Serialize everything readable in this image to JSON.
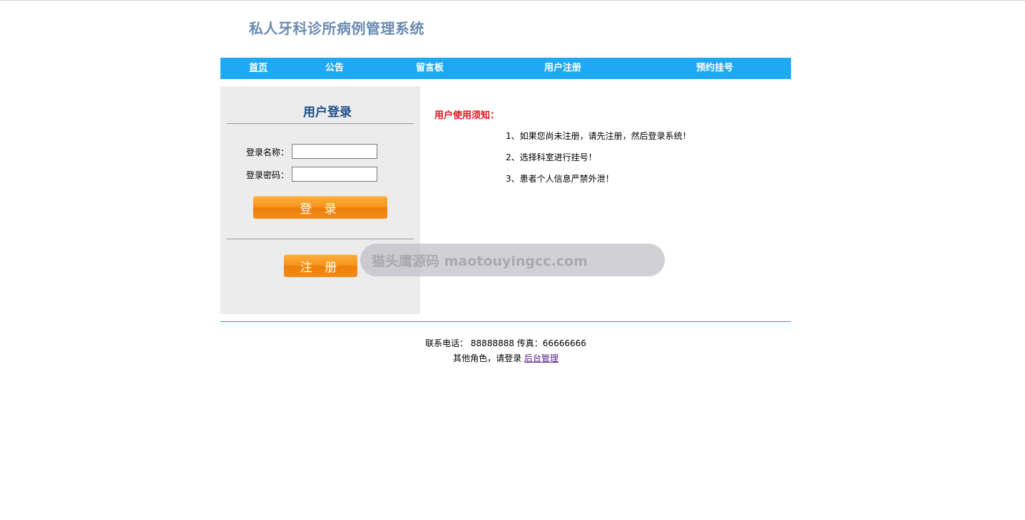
{
  "header": {
    "title": "私人牙科诊所病例管理系统"
  },
  "nav": {
    "items": [
      {
        "label": "首页"
      },
      {
        "label": "公告"
      },
      {
        "label": "留言板"
      },
      {
        "label": "用户注册"
      },
      {
        "label": "预约挂号"
      }
    ]
  },
  "login": {
    "title": "用户登录",
    "username_label": "登录名称：",
    "username_value": "",
    "password_label": "登录密码：",
    "password_value": "",
    "login_button": "登 录",
    "register_button": "注 册"
  },
  "notice": {
    "title": "用户使用须知：",
    "items": [
      "1、如果您尚未注册，请先注册，然后登录系统！",
      "2、选择科室进行挂号！",
      "3、患者个人信息严禁外泄！"
    ]
  },
  "watermark": {
    "text": "猫头鹰源码 maotouyingcc.com"
  },
  "footer": {
    "contact": "联系电话： 88888888 传真：66666666",
    "other_roles": "其他角色，请登录 ",
    "admin_link": "后台管理"
  },
  "colors": {
    "nav_bg": "#1fa9f5",
    "title": "#6a8bb0",
    "login_title": "#1a4f8a",
    "notice_title": "#e0101a",
    "button": "#f7941d"
  }
}
